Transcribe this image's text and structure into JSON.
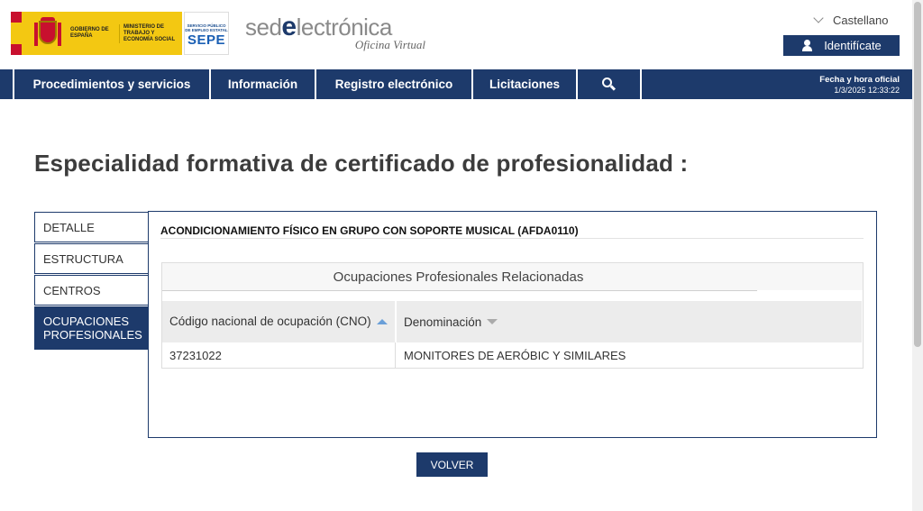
{
  "header": {
    "gov_text": "GOBIERNO DE ESPAÑA",
    "ministry_text": "MINISTERIO DE TRABAJO Y ECONOMÍA SOCIAL",
    "sepe_small": "SERVICIO PÚBLICO DE EMPLEO ESTATAL",
    "sepe_big": "SEPE",
    "sede_prefix": "sed",
    "sede_e": "e",
    "sede_suffix": "lectrónica",
    "sede_sub": "Oficina Virtual",
    "language": "Castellano",
    "identify_label": "Identifícate"
  },
  "nav": {
    "items": [
      {
        "label": "Procedimientos y servicios"
      },
      {
        "label": "Información"
      },
      {
        "label": "Registro electrónico"
      },
      {
        "label": "Licitaciones"
      }
    ],
    "search_icon": "search-icon",
    "date_label": "Fecha y hora oficial",
    "date_value": "1/3/2025 12:33:22"
  },
  "page": {
    "title": "Especialidad formativa de certificado de profesionalidad :"
  },
  "tabs": [
    {
      "label": "DETALLE"
    },
    {
      "label": "ESTRUCTURA"
    },
    {
      "label": "CENTROS"
    },
    {
      "label": "OCUPACIONES PROFESIONALES",
      "active": true
    }
  ],
  "content": {
    "specialty_title": "ACONDICIONAMIENTO FÍSICO EN GRUPO CON SOPORTE MUSICAL (AFDA0110)",
    "table_caption": "Ocupaciones Profesionales Relacionadas",
    "columns": [
      {
        "label": "Código nacional de ocupación (CNO)",
        "sort": "asc"
      },
      {
        "label": "Denominación",
        "sort": "desc"
      }
    ],
    "rows": [
      {
        "code": "37231022",
        "name": "MONITORES DE AERÓBIC Y SIMILARES"
      }
    ]
  },
  "actions": {
    "back_label": "VOLVER"
  },
  "colors": {
    "brand_navy": "#1d3a6b",
    "gov_yellow": "#f3c812",
    "sort_blue": "#6a9fd8"
  }
}
